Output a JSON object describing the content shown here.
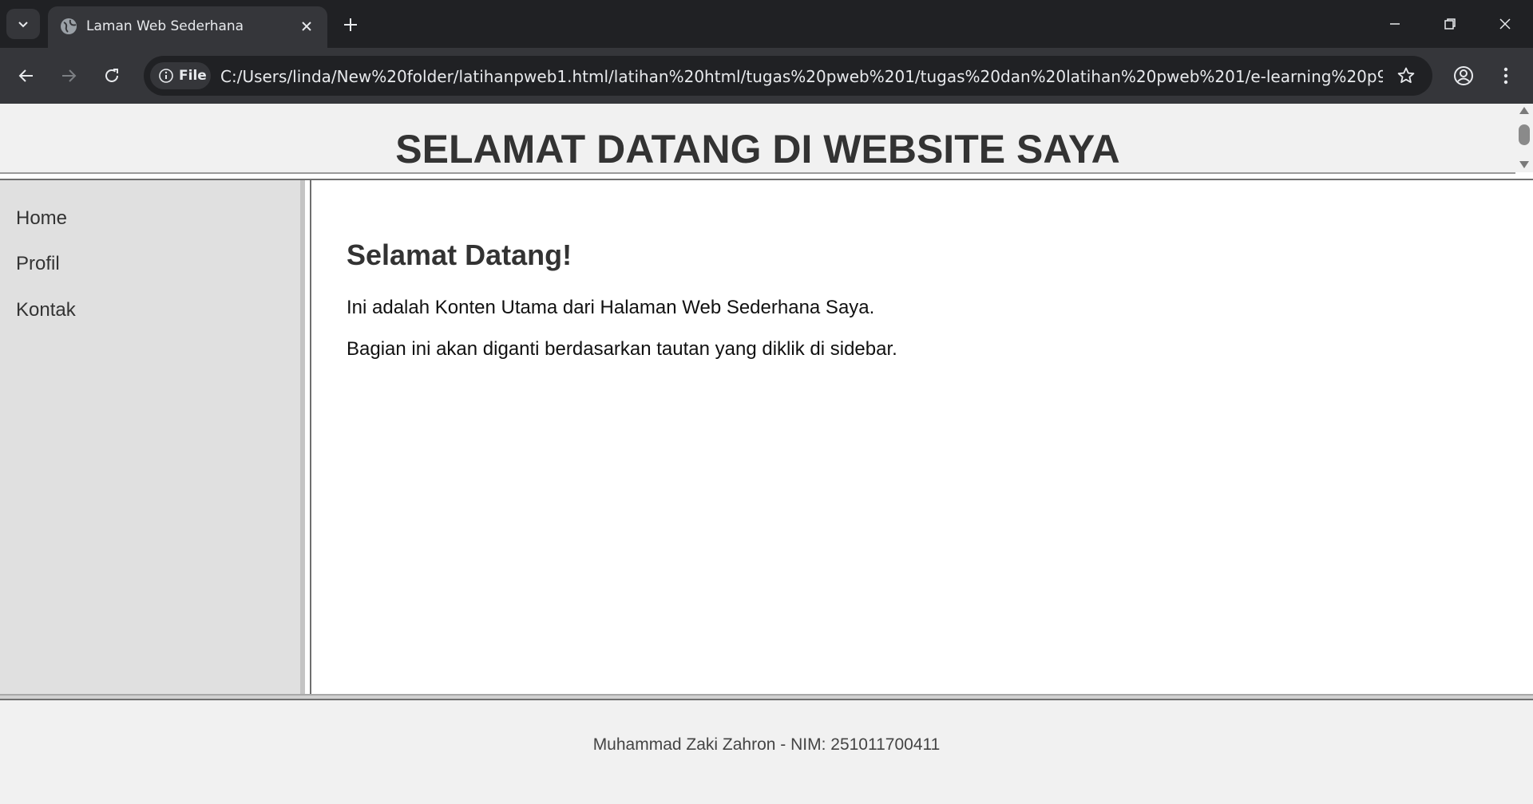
{
  "browser": {
    "tab_title": "Laman Web Sederhana",
    "address_chip": "File",
    "url": "C:/Users/linda/New%20folder/latihanpweb1.html/latihan%20html/tugas%20pweb%201/tugas%20dan%20latihan%20pweb%201/e-learning%20p9%20inde..."
  },
  "page": {
    "header_title": "SELAMAT DATANG DI WEBSITE SAYA",
    "sidebar": {
      "items": [
        {
          "label": "Home"
        },
        {
          "label": "Profil"
        },
        {
          "label": "Kontak"
        }
      ]
    },
    "main": {
      "heading": "Selamat Datang!",
      "paragraphs": [
        "Ini adalah Konten Utama dari Halaman Web Sederhana Saya.",
        "Bagian ini akan diganti berdasarkan tautan yang diklik di sidebar."
      ]
    },
    "footer": "Muhammad Zaki Zahron - NIM: 251011700411"
  },
  "icons": {
    "tab_search": "chevron-down-icon",
    "favicon": "globe-icon",
    "tab_close": "close-icon",
    "new_tab": "plus-icon",
    "minimize": "minimize-icon",
    "restore": "restore-icon",
    "close_window": "close-icon",
    "back": "arrow-left-icon",
    "forward": "arrow-right-icon",
    "reload": "reload-icon",
    "info": "info-icon",
    "bookmark": "star-icon",
    "profile": "account-icon",
    "menu": "kebab-menu-icon"
  },
  "colors": {
    "chrome_dark": "#202124",
    "chrome_toolbar": "#35363a",
    "header_bg": "#f1f1f1",
    "sidebar_bg": "#e0e0e0",
    "text_dark": "#333333"
  }
}
